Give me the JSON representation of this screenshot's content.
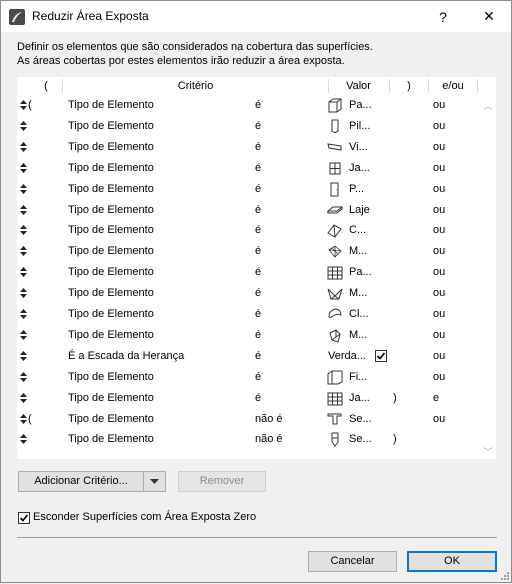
{
  "window": {
    "title": "Reduzir Área Exposta",
    "help_label": "?",
    "close_label": "✕"
  },
  "description": {
    "line1": "Definir os elementos que são considerados na cobertura das superfícies.",
    "line2": "As áreas cobertas por estes elementos irão reduzir a área exposta."
  },
  "table": {
    "headers": {
      "open": "(",
      "criterion": "Critério",
      "value": "Valor",
      "close": ")",
      "andor": "e/ou"
    },
    "rows": [
      {
        "open": "(",
        "criterion": "Tipo de Elemento",
        "operator": "é",
        "icon": "wall-icon",
        "value": "Pa...",
        "close": "",
        "andor": "ou"
      },
      {
        "open": "",
        "criterion": "Tipo de Elemento",
        "operator": "é",
        "icon": "column-icon",
        "value": "Pil...",
        "close": "",
        "andor": "ou"
      },
      {
        "open": "",
        "criterion": "Tipo de Elemento",
        "operator": "é",
        "icon": "beam-icon",
        "value": "Vi...",
        "close": "",
        "andor": "ou"
      },
      {
        "open": "",
        "criterion": "Tipo de Elemento",
        "operator": "é",
        "icon": "window-icon",
        "value": "Ja...",
        "close": "",
        "andor": "ou"
      },
      {
        "open": "",
        "criterion": "Tipo de Elemento",
        "operator": "é",
        "icon": "door-icon",
        "value": "P...",
        "close": "",
        "andor": "ou"
      },
      {
        "open": "",
        "criterion": "Tipo de Elemento",
        "operator": "é",
        "icon": "slab-icon",
        "value": "Laje",
        "close": "",
        "andor": "ou"
      },
      {
        "open": "",
        "criterion": "Tipo de Elemento",
        "operator": "é",
        "icon": "roof-icon",
        "value": "C...",
        "close": "",
        "andor": "ou"
      },
      {
        "open": "",
        "criterion": "Tipo de Elemento",
        "operator": "é",
        "icon": "mesh-icon",
        "value": "M...",
        "close": "",
        "andor": "ou"
      },
      {
        "open": "",
        "criterion": "Tipo de Elemento",
        "operator": "é",
        "icon": "curtain-wall-icon",
        "value": "Pa...",
        "close": "",
        "andor": "ou"
      },
      {
        "open": "",
        "criterion": "Tipo de Elemento",
        "operator": "é",
        "icon": "morph-icon",
        "value": "M...",
        "close": "",
        "andor": "ou"
      },
      {
        "open": "",
        "criterion": "Tipo de Elemento",
        "operator": "é",
        "icon": "shell-icon",
        "value": "Cl...",
        "close": "",
        "andor": "ou"
      },
      {
        "open": "",
        "criterion": "Tipo de Elemento",
        "operator": "é",
        "icon": "object-icon",
        "value": "M...",
        "close": "",
        "andor": "ou"
      },
      {
        "open": "",
        "criterion": "É a Escada da Herança",
        "operator": "é",
        "icon": "",
        "value": "Verda...",
        "checkbox": true,
        "close": "",
        "andor": "ou"
      },
      {
        "open": "",
        "criterion": "Tipo de Elemento",
        "operator": "é",
        "icon": "fill-icon",
        "value": "Fi...",
        "close": "",
        "andor": "ou"
      },
      {
        "open": "",
        "criterion": "Tipo de Elemento",
        "operator": "é",
        "icon": "curtain-wall-icon",
        "value": "Ja...",
        "close": ")",
        "andor": "e"
      },
      {
        "open": "(",
        "criterion": "Tipo de Elemento",
        "operator": "não é",
        "icon": "section-icon",
        "value": "Se...",
        "close": "",
        "andor": "ou"
      },
      {
        "open": "",
        "criterion": "Tipo de Elemento",
        "operator": "não é",
        "icon": "section-elev-icon",
        "value": "Se...",
        "close": ")",
        "andor": ""
      }
    ]
  },
  "buttons": {
    "add_criterion": "Adicionar Critério...",
    "remove": "Remover",
    "cancel": "Cancelar",
    "ok": "OK"
  },
  "hide_zero": {
    "label": "Esconder Superfícies com Área Exposta Zero",
    "checked": true
  }
}
